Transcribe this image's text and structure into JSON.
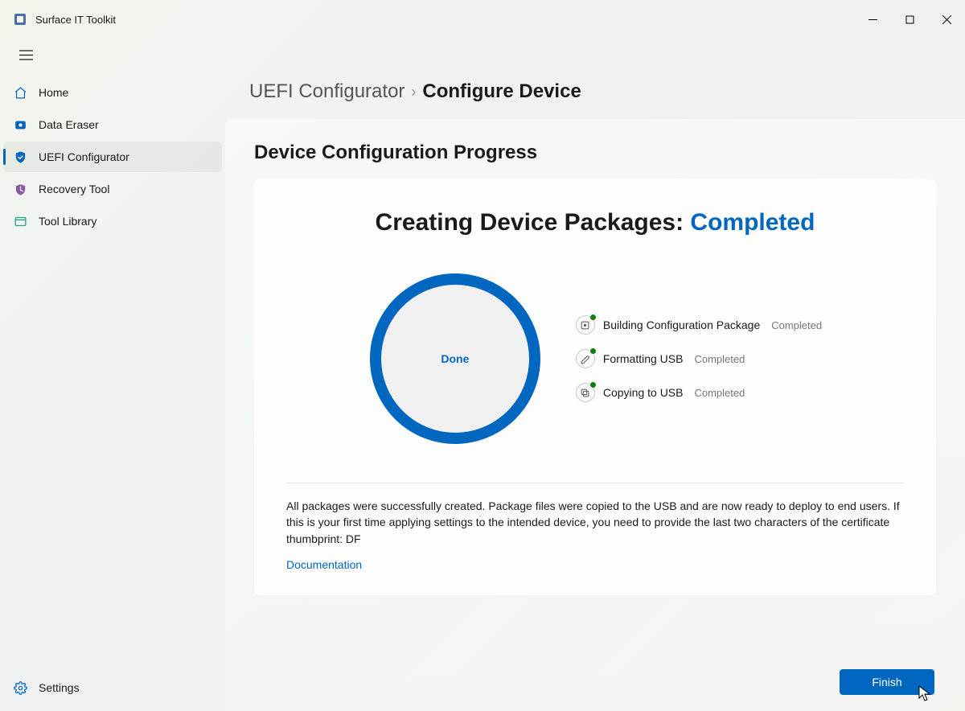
{
  "app": {
    "title": "Surface IT Toolkit"
  },
  "sidebar": {
    "items": [
      {
        "label": "Home"
      },
      {
        "label": "Data Eraser"
      },
      {
        "label": "UEFI Configurator"
      },
      {
        "label": "Recovery Tool"
      },
      {
        "label": "Tool Library"
      }
    ],
    "settings_label": "Settings"
  },
  "breadcrumb": {
    "parent": "UEFI Configurator",
    "current": "Configure Device"
  },
  "section": {
    "title": "Device Configuration Progress"
  },
  "package": {
    "heading_prefix": "Creating Device Packages:",
    "heading_status": "Completed",
    "ring_label": "Done",
    "steps": [
      {
        "label": "Building Configuration Package",
        "status": "Completed"
      },
      {
        "label": "Formatting USB",
        "status": "Completed"
      },
      {
        "label": "Copying to USB",
        "status": "Completed"
      }
    ],
    "description": "All packages were successfully created. Package files were copied to the USB and are now ready to deploy to end users. If this is your first time applying settings to the intended device, you need to provide the last two characters of the certificate thumbprint: DF",
    "doc_link": "Documentation"
  },
  "buttons": {
    "finish": "Finish"
  }
}
